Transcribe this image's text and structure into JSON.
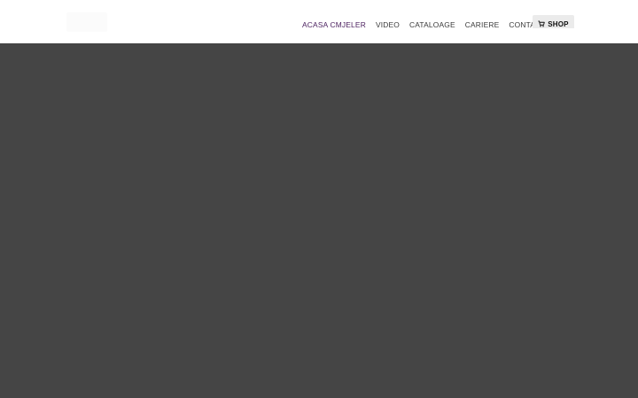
{
  "colors": {
    "header_bg": "#ffffff",
    "hero_bg": "#454545",
    "nav_text": "#3a3a3a",
    "nav_active": "#4a1f5e",
    "shop_bg": "#ebebeb"
  },
  "nav": {
    "items": [
      {
        "label": "ACASA CMJELER",
        "active": true
      },
      {
        "label": "VIDEO",
        "active": false
      },
      {
        "label": "CATALOAGE",
        "active": false
      },
      {
        "label": "CARIERE",
        "active": false
      },
      {
        "label": "CONTACT",
        "active": false
      }
    ],
    "shop": {
      "icon": "cart-icon",
      "label": "SHOP"
    }
  }
}
